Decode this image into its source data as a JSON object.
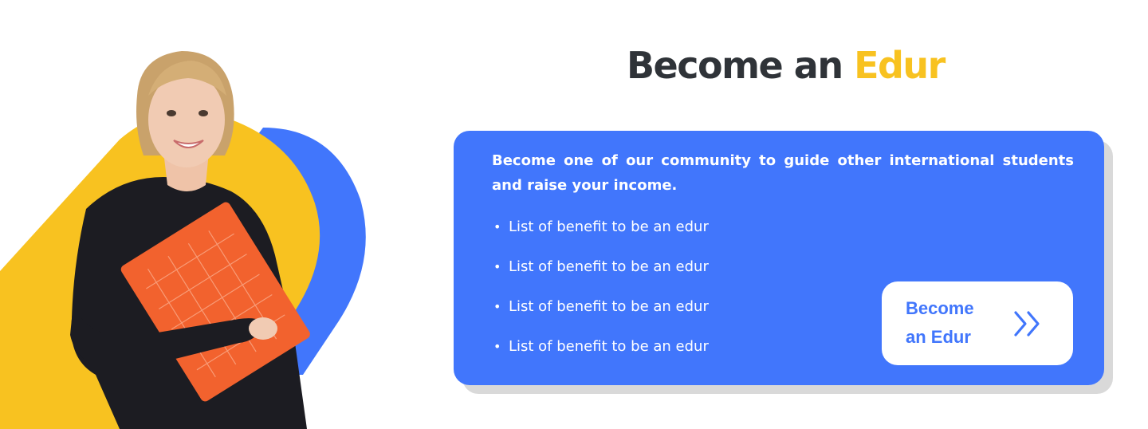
{
  "heading": {
    "prefix": "Become an ",
    "accent": "Edur"
  },
  "card": {
    "intro": "Become one of our community to guide other international students and raise your income.",
    "benefits": [
      "List of benefit to be an edur",
      "List of benefit to be an edur",
      "List of benefit to be an edur",
      "List of benefit to be an edur"
    ],
    "bullet": "•",
    "cta": {
      "line1": "Become",
      "line2": "an Edur",
      "icon": "double-chevron-right-icon"
    }
  },
  "colors": {
    "brand_blue": "#4176fc",
    "accent_yellow": "#f8c220",
    "heading_dark": "#2f3338",
    "folder_orange": "#f2622e"
  }
}
